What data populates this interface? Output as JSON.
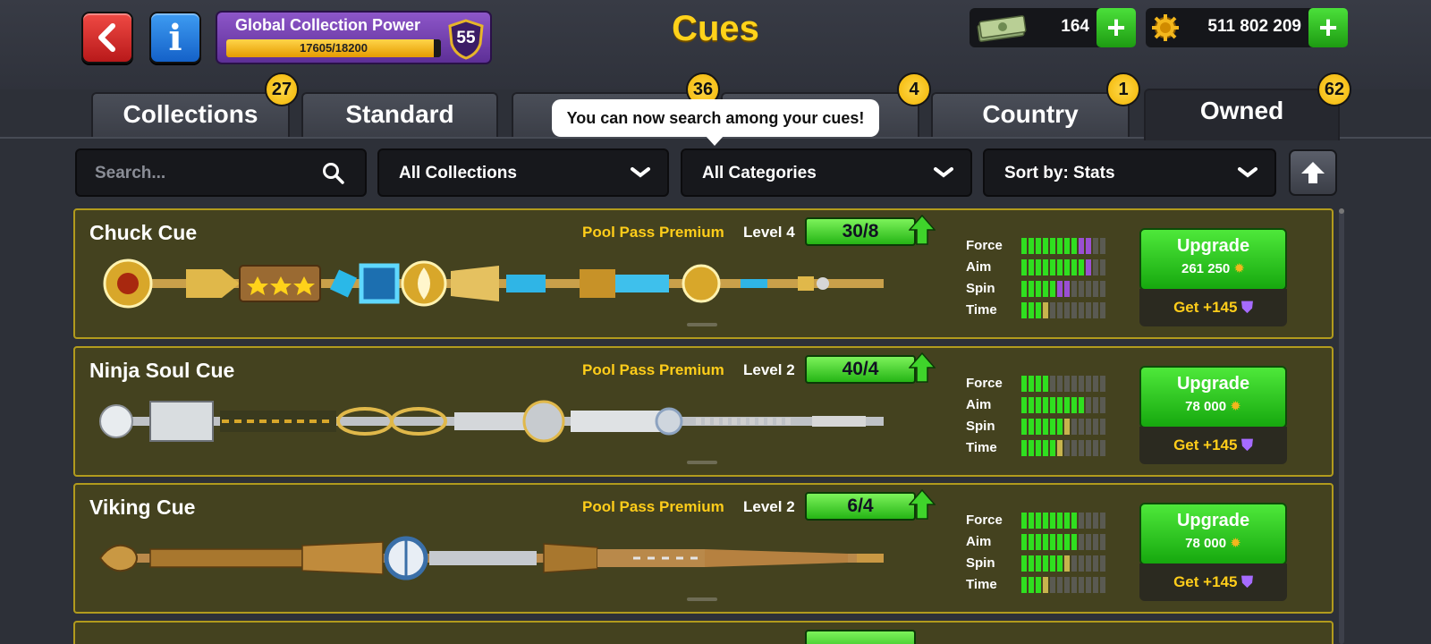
{
  "header": {
    "title": "Cues",
    "global_collection": {
      "title": "Global Collection Power",
      "progress_text": "17605/18200",
      "progress_fraction": 0.967,
      "level": "55"
    },
    "currencies": {
      "cash": "164",
      "coins": "511 802 209"
    }
  },
  "tabs": [
    {
      "label": "Collections",
      "badge": "27"
    },
    {
      "label": "Standard",
      "badge": ""
    },
    {
      "label": "",
      "badge": "36"
    },
    {
      "label": "",
      "badge": "4"
    },
    {
      "label": "Country",
      "badge": "1"
    },
    {
      "label": "Owned",
      "badge": "62"
    }
  ],
  "tooltip": "You can now search among your cues!",
  "filters": {
    "search_placeholder": "Search...",
    "collections": "All Collections",
    "categories": "All Categories",
    "sort": "Sort by: Stats"
  },
  "cues": [
    {
      "name": "Chuck Cue",
      "pass": "Pool Pass Premium",
      "level": "Level 4",
      "progress": "30/8",
      "stats": {
        "force": {
          "label": "Force",
          "green": 8,
          "extra": 2,
          "extra_color": "p"
        },
        "aim": {
          "label": "Aim",
          "green": 9,
          "extra": 1,
          "extra_color": "p"
        },
        "spin": {
          "label": "Spin",
          "green": 5,
          "extra": 2,
          "extra_color": "p"
        },
        "time": {
          "label": "Time",
          "green": 3,
          "extra": 1,
          "extra_color": "o"
        }
      },
      "upgrade_label": "Upgrade",
      "upgrade_cost": "261 250",
      "get_label": "Get +145"
    },
    {
      "name": "Ninja Soul Cue",
      "pass": "Pool Pass Premium",
      "level": "Level 2",
      "progress": "40/4",
      "stats": {
        "force": {
          "label": "Force",
          "green": 4,
          "extra": 0,
          "extra_color": "o"
        },
        "aim": {
          "label": "Aim",
          "green": 9,
          "extra": 0,
          "extra_color": "o"
        },
        "spin": {
          "label": "Spin",
          "green": 6,
          "extra": 1,
          "extra_color": "o"
        },
        "time": {
          "label": "Time",
          "green": 5,
          "extra": 1,
          "extra_color": "o"
        }
      },
      "upgrade_label": "Upgrade",
      "upgrade_cost": "78 000",
      "get_label": "Get +145"
    },
    {
      "name": "Viking Cue",
      "pass": "Pool Pass Premium",
      "level": "Level 2",
      "progress": "6/4",
      "stats": {
        "force": {
          "label": "Force",
          "green": 8,
          "extra": 0,
          "extra_color": "o"
        },
        "aim": {
          "label": "Aim",
          "green": 8,
          "extra": 0,
          "extra_color": "o"
        },
        "spin": {
          "label": "Spin",
          "green": 6,
          "extra": 1,
          "extra_color": "o"
        },
        "time": {
          "label": "Time",
          "green": 3,
          "extra": 1,
          "extra_color": "o"
        }
      },
      "upgrade_label": "Upgrade",
      "upgrade_cost": "78 000",
      "get_label": "Get +145"
    }
  ],
  "colors": {
    "accent_yellow": "#ffd21a",
    "green": "#2fdf1f",
    "card_border": "#b29b1d"
  }
}
